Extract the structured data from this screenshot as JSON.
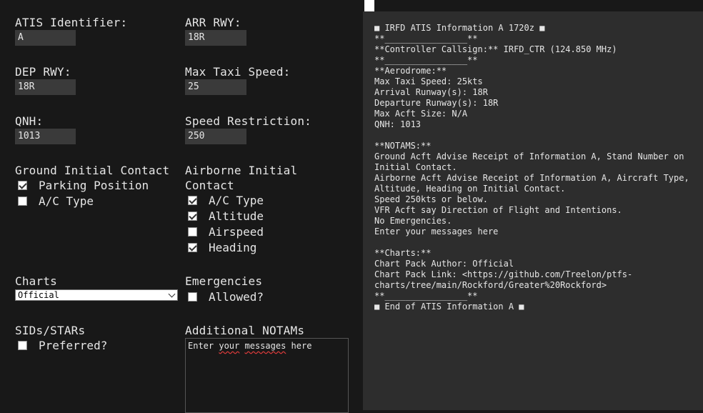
{
  "form": {
    "atis_label": "ATIS Identifier:",
    "atis_value": "A",
    "arr_label": "ARR RWY:",
    "arr_value": "18R",
    "dep_label": "DEP RWY:",
    "dep_value": "18R",
    "taxi_label": "Max Taxi Speed:",
    "taxi_value": "25",
    "qnh_label": "QNH:",
    "qnh_value": "1013",
    "speed_label": "Speed Restriction:",
    "speed_value": "250",
    "ground_label": "Ground Initial Contact",
    "ground_opts": [
      "Parking Position",
      "A/C Type"
    ],
    "airborne_label_1": "Airborne Initial",
    "airborne_label_2": "Contact",
    "airborne_opts": [
      "A/C Type",
      "Altitude",
      "Airspeed",
      "Heading"
    ],
    "charts_label": "Charts",
    "charts_selected": "Official",
    "emerg_label": "Emergencies",
    "emerg_opt": "Allowed?",
    "sids_label": "SIDs/STARs",
    "sids_opt": "Preferred?",
    "notams_label": "Additional NOTAMs",
    "notams_text_1": "Enter ",
    "notams_text_2": "your",
    "notams_text_3": " ",
    "notams_text_4": "messages",
    "notams_text_5": " here"
  },
  "output": {
    "lines": [
      "■ IRFD ATIS Information A 1720z ■",
      "**________________**",
      "**Controller Callsign:** IRFD_CTR (124.850 MHz)",
      "**________________**",
      "**Aerodrome:**",
      "Max Taxi Speed: 25kts",
      "Arrival Runway(s): 18R",
      "Departure Runway(s): 18R",
      "Max Acft Size: N/A",
      "QNH: 1013",
      "",
      "**NOTAMS:**",
      "Ground Acft Advise Receipt of Information A, Stand Number on Initial Contact.",
      "Airborne Acft Advise Receipt of Information A, Aircraft Type, Altitude, Heading on Initial Contact.",
      "Speed 250kts or below.",
      "VFR Acft say Direction of Flight and Intentions.",
      "No Emergencies.",
      "Enter your messages here",
      "",
      "**Charts:**",
      "Chart Pack Author: Official",
      "Chart Pack Link: <https://github.com/Treelon/ptfs-charts/tree/main/Rockford/Greater%20Rockford>",
      "**________________**",
      "■ End of ATIS Information A ■"
    ]
  }
}
